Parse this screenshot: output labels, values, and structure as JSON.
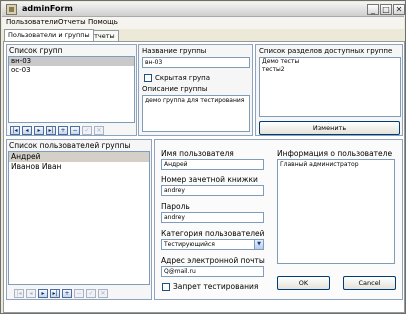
{
  "window": {
    "title": "adminForm"
  },
  "menu": [
    "Пользователи",
    "Отчеты",
    "Помощь"
  ],
  "tabs": [
    "Пользователи и группы",
    "Отчеты"
  ],
  "groups": {
    "list_label": "Список групп",
    "items": [
      "вн-03",
      "ос-03"
    ],
    "name_label": "Название группы",
    "name_value": "вн-03",
    "hidden_label": "Скрытая група",
    "desc_label": "Описание группы",
    "desc_value": "демо группа для тестирования",
    "sections_label": "Список разделов доступных группе",
    "sections_items": [
      "Демо тесты",
      "тесты2"
    ],
    "change_button": "Изменить"
  },
  "users": {
    "list_label": "Список пользователей группы",
    "items": [
      "Андрей",
      "Иванов Иван"
    ],
    "username_label": "Имя пользователя",
    "username_value": "Андрей",
    "record_label": "Номер зачетной книжки",
    "record_value": "andrey",
    "password_label": "Пароль",
    "password_value": "andrey",
    "category_label": "Категория пользователей",
    "category_value": "Тестирующийся",
    "email_label": "Адрес электронной почты",
    "email_value": "Q@mail.ru",
    "ban_label": "Запрет тестирования",
    "info_label": "Информация о пользователе",
    "info_value": "Главный администратор",
    "ok_button": "OK",
    "cancel_button": "Cancel"
  },
  "nav_icons": [
    "first-icon",
    "prev-icon",
    "next-icon",
    "last-icon",
    "add-icon",
    "delete-icon",
    "edit-icon",
    "cancel-edit-icon"
  ]
}
